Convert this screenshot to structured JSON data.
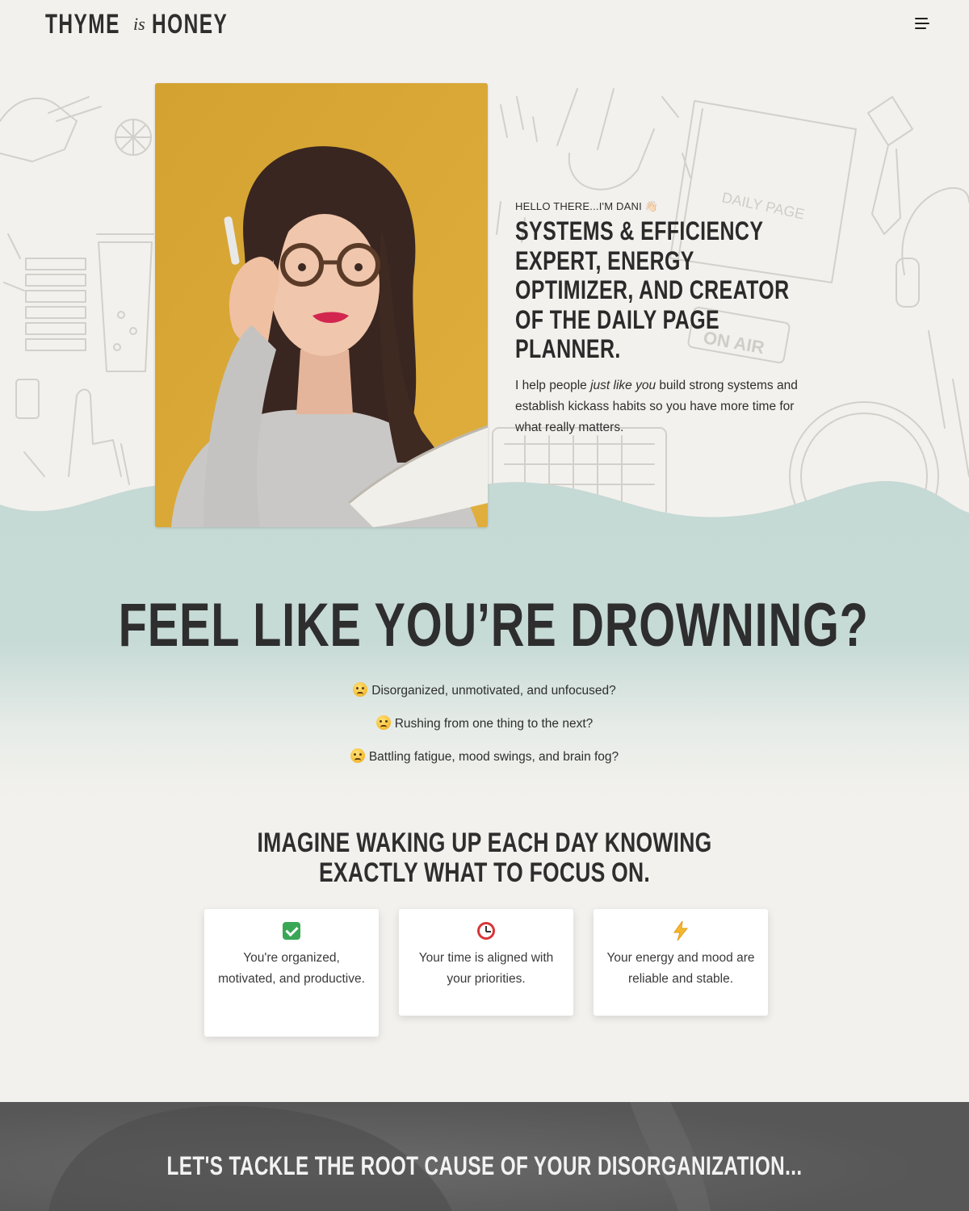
{
  "header": {
    "logo": {
      "word1": "THYME",
      "word2": "is",
      "word3": "HONEY"
    },
    "menu_icon": "hamburger-menu-icon"
  },
  "hero": {
    "eyebrow": "HELLO THERE...I'M DANI 👋🏻",
    "title": "SYSTEMS & EFFICIENCY EXPERT, ENERGY OPTIMIZER, AND CREATOR OF THE DAILY PAGE PLANNER.",
    "body_before": "I help people ",
    "body_emphasis": "just like you",
    "body_after": " build strong systems and establish kickass habits so you have more time for what really matters.",
    "background_sketch_text": {
      "planner_label": "DAILY PAGE",
      "sign_label": "ON AIR"
    }
  },
  "problem": {
    "title": "FEEL LIKE YOU’RE DROWNING?",
    "items": [
      {
        "emoji": "persevering-face",
        "text": "Disorganized, unmotivated, and unfocused?"
      },
      {
        "emoji": "weary-face",
        "text": "Rushing from one thing to the next?"
      },
      {
        "emoji": "disappointed-face",
        "text": "Battling fatigue, mood swings, and brain fog?"
      }
    ]
  },
  "imagine": {
    "title": "IMAGINE WAKING UP EACH DAY KNOWING EXACTLY WHAT TO FOCUS ON.",
    "cards": [
      {
        "icon": "check-mark-icon",
        "text": "You're organized, motivated, and productive."
      },
      {
        "icon": "alarm-clock-icon",
        "text": "Your time is aligned with your priorities."
      },
      {
        "icon": "lightning-icon",
        "text": "Your energy and mood are reliable and stable."
      }
    ]
  },
  "cta_band": {
    "title": "LET'S TACKLE THE ROOT CAUSE OF YOUR DISORGANIZATION..."
  },
  "colors": {
    "page_bg": "#f3f1ed",
    "wave_teal": "#c5d9d5",
    "photo_bg": "#d9a835",
    "text_dark": "#2e2e2e",
    "band_gray": "#5a5a5a"
  }
}
